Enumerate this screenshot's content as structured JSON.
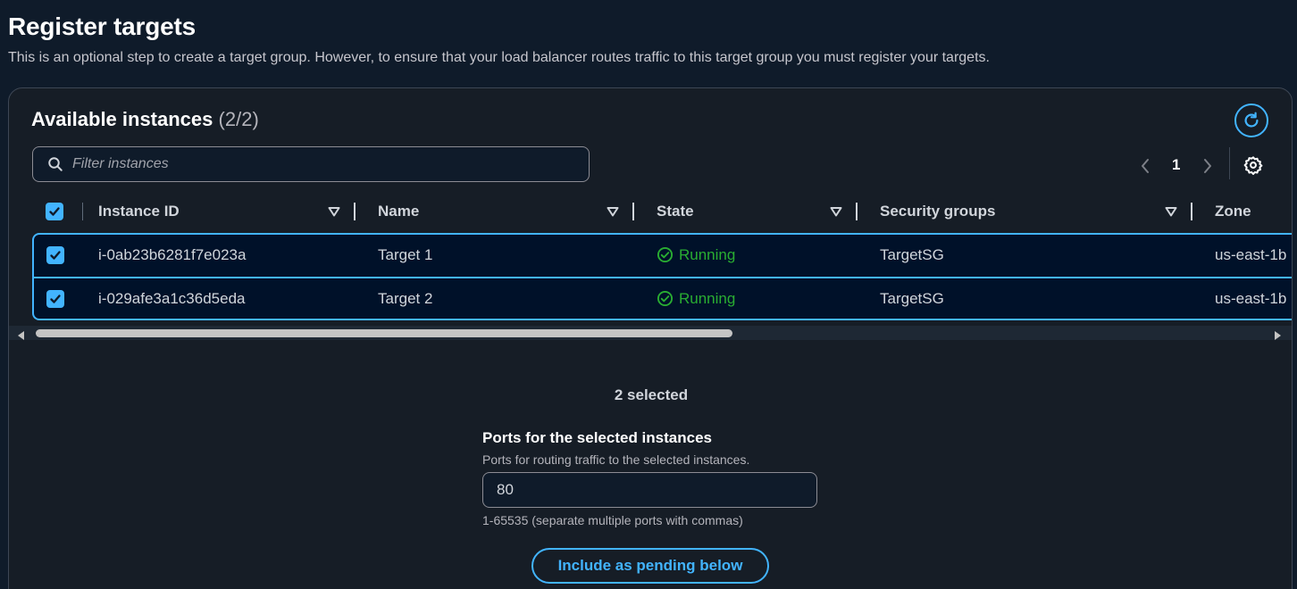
{
  "page": {
    "title": "Register targets",
    "description": "This is an optional step to create a target group. However, to ensure that your load balancer routes traffic to this target group you must register your targets."
  },
  "instances_panel": {
    "title": "Available instances",
    "count": "(2/2)",
    "search_placeholder": "Filter instances",
    "pagination": {
      "current_page": "1"
    },
    "columns": [
      "Instance ID",
      "Name",
      "State",
      "Security groups",
      "Zone"
    ],
    "rows": [
      {
        "checked": true,
        "instance_id": "i-0ab23b6281f7e023a",
        "name": "Target 1",
        "state": "Running",
        "security_groups": "TargetSG",
        "zone": "us-east-1b"
      },
      {
        "checked": true,
        "instance_id": "i-029afe3a1c36d5eda",
        "name": "Target 2",
        "state": "Running",
        "security_groups": "TargetSG",
        "zone": "us-east-1b"
      }
    ],
    "selected_summary": "2 selected"
  },
  "ports": {
    "label": "Ports for the selected instances",
    "description": "Ports for routing traffic to the selected instances.",
    "value": "80",
    "hint": "1-65535 (separate multiple ports with commas)"
  },
  "pending_button_label": "Include as pending below",
  "colors": {
    "background": "#0f1b2a",
    "panel": "#161d26",
    "accent": "#42b4ff",
    "success": "#29ad32",
    "selected_row": "#001129"
  },
  "icons": [
    "search-icon",
    "refresh-icon",
    "chevron-left-icon",
    "chevron-right-icon",
    "settings-icon",
    "sort-down-icon",
    "check-circle-icon",
    "checkbox-checked-icon"
  ]
}
